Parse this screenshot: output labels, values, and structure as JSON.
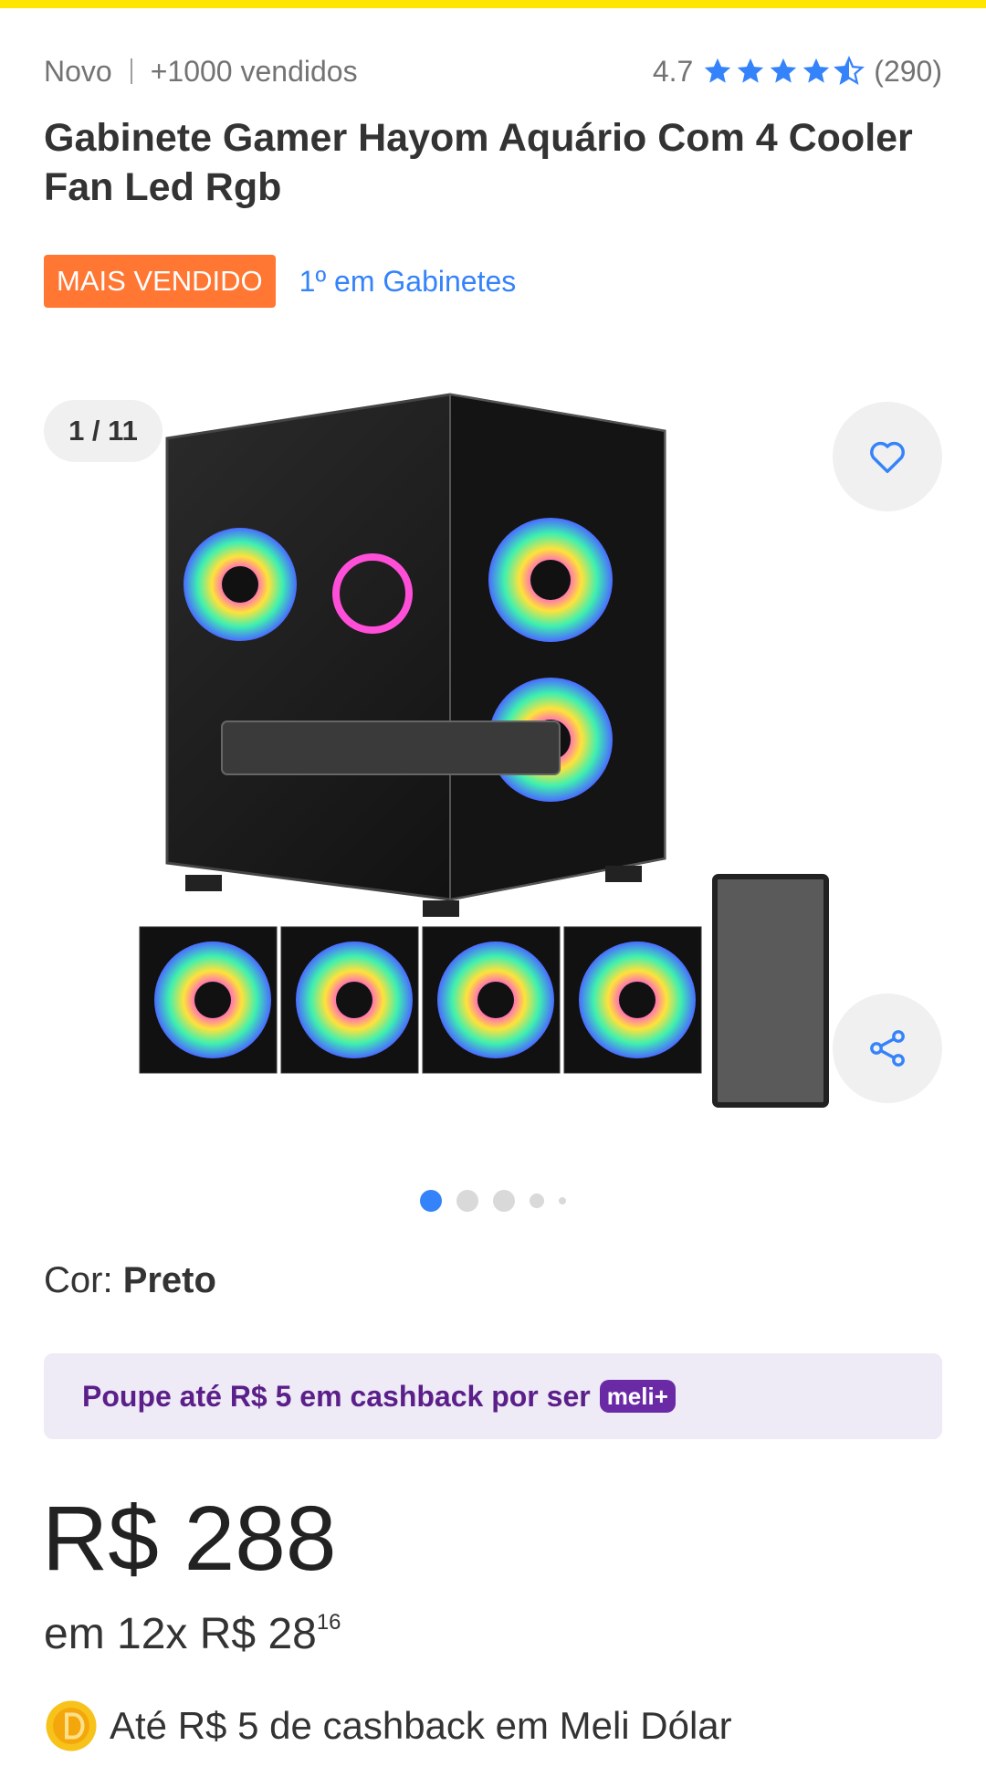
{
  "colors": {
    "accent_blue": "#3483fa",
    "badge_orange": "#ff7733",
    "meli_purple": "#6b2aa5",
    "top_strip_yellow": "#ffe600"
  },
  "meta": {
    "condition": "Novo",
    "sold": "+1000 vendidos",
    "rating": "4.7",
    "review_count": "(290)",
    "stars_value": 4.7
  },
  "product": {
    "title": "Gabinete Gamer Hayom Aquário Com 4 Cooler Fan Led Rgb",
    "badge": "MAIS VENDIDO",
    "rank_link": "1º em Gabinetes"
  },
  "gallery": {
    "counter": "1 / 11",
    "total_images": 11,
    "current_index": 1,
    "fav_icon": "heart-icon",
    "share_icon": "share-icon"
  },
  "variant": {
    "label": "Cor: ",
    "value": "Preto"
  },
  "cashback_banner": {
    "text": "Poupe até R$ 5 em cashback por ser",
    "badge": "meli+"
  },
  "pricing": {
    "price": "R$ 288",
    "installments_prefix": "em 12x R$ 28",
    "installments_cents": "16"
  },
  "meli_dolar": {
    "icon": "coin-icon",
    "text": "Até R$ 5 de cashback em Meli Dólar"
  }
}
